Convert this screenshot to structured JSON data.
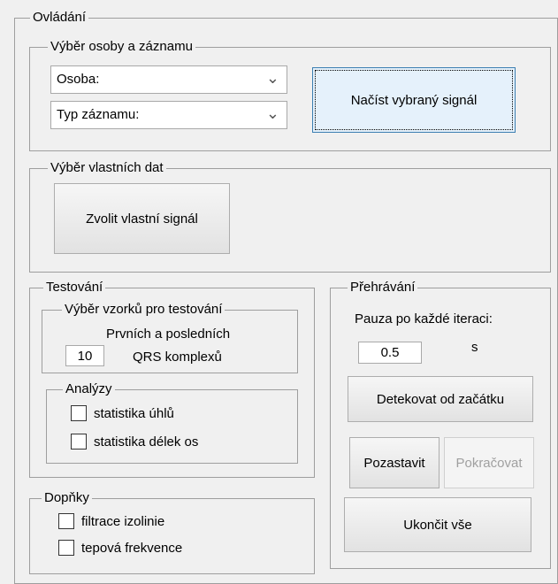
{
  "ovladani": {
    "title": "Ovládání"
  },
  "vyber_osoby": {
    "title": "Výběr osoby a záznamu",
    "osoba_placeholder": "Osoba:",
    "typ_placeholder": "Typ záznamu:",
    "dropdown_icon": "chevron-down-icon",
    "load_button": "Načíst vybraný signál"
  },
  "vyber_vlastnich": {
    "title": "Výběr vlastních dat",
    "choose_button": "Zvolit vlastní signál"
  },
  "testovani": {
    "title": "Testování",
    "vzorky": {
      "title": "Výběr vzorků pro testování",
      "line1": "Prvních a posledních",
      "count": "10",
      "line2": "QRS komplexů"
    },
    "analyzy": {
      "title": "Analýzy",
      "items": [
        "statistika úhlů",
        "statistika délek os"
      ]
    }
  },
  "doplnky": {
    "title": "Dopňky",
    "items": [
      "filtrace izolinie",
      "tepová frekvence"
    ]
  },
  "prehravani": {
    "title": "Přehrávání",
    "pause_label": "Pauza po každé iteraci:",
    "pause_value": "0.5",
    "unit": "s",
    "detect_button": "Detekovat od začátku",
    "pause_button": "Pozastavit",
    "continue_button": "Pokračovat",
    "end_button": "Ukončit vše"
  }
}
